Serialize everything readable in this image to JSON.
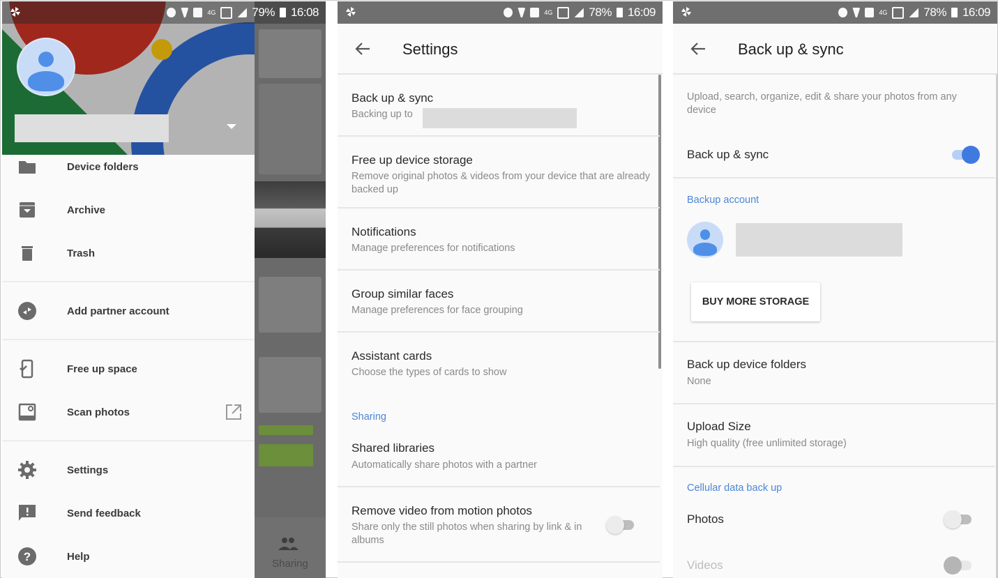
{
  "panels": {
    "drawer": {
      "status_bar": {
        "battery": "79%",
        "time": "16:08",
        "network": "4G"
      },
      "account_name": "",
      "items": [
        {
          "label": "Device folders",
          "icon": "folder-icon"
        },
        {
          "label": "Archive",
          "icon": "archive-icon"
        },
        {
          "label": "Trash",
          "icon": "trash-icon"
        },
        {
          "label": "Add partner account",
          "icon": "partner-icon"
        },
        {
          "label": "Free up space",
          "icon": "phone-check-icon"
        },
        {
          "label": "Scan photos",
          "icon": "scan-photo-icon",
          "external": true
        },
        {
          "label": "Settings",
          "icon": "gear-icon"
        },
        {
          "label": "Send feedback",
          "icon": "feedback-icon"
        },
        {
          "label": "Help",
          "icon": "help-icon"
        }
      ],
      "background_nav_label": "Sharing"
    },
    "settings": {
      "status_bar": {
        "battery": "78%",
        "time": "16:09",
        "network": "4G"
      },
      "title": "Settings",
      "items": [
        {
          "title": "Back up & sync",
          "subtitle": "Backing up to"
        },
        {
          "title": "Free up device storage",
          "subtitle": "Remove original photos & videos from your device that are already backed up"
        },
        {
          "title": "Notifications",
          "subtitle": "Manage preferences for notifications"
        },
        {
          "title": "Group similar faces",
          "subtitle": "Manage preferences for face grouping"
        },
        {
          "title": "Assistant cards",
          "subtitle": "Choose the types of cards to show"
        }
      ],
      "sharing_section": "Sharing",
      "sharing_items": [
        {
          "title": "Shared libraries",
          "subtitle": "Automatically share photos with a partner"
        },
        {
          "title": "Remove video from motion photos",
          "subtitle": "Share only the still photos when sharing by link & in albums",
          "toggle": false
        }
      ]
    },
    "backup": {
      "status_bar": {
        "battery": "78%",
        "time": "16:09",
        "network": "4G"
      },
      "title": "Back up & sync",
      "description": "Upload, search, organize, edit & share your photos from any device",
      "backup_toggle_label": "Back up & sync",
      "backup_toggle_on": true,
      "backup_account_section": "Backup account",
      "buy_storage_label": "BUY MORE STORAGE",
      "device_folders": {
        "title": "Back up device folders",
        "subtitle": "None"
      },
      "upload_size": {
        "title": "Upload Size",
        "subtitle": "High quality (free unlimited storage)"
      },
      "cellular_section": "Cellular data back up",
      "cellular_photos": {
        "label": "Photos",
        "on": false
      },
      "cellular_videos": {
        "label": "Videos",
        "on": false,
        "disabled": true
      }
    }
  },
  "colors": {
    "accent": "#3f7ae0",
    "section": "#4a86d8",
    "status_bar": "#6f6f6f"
  }
}
